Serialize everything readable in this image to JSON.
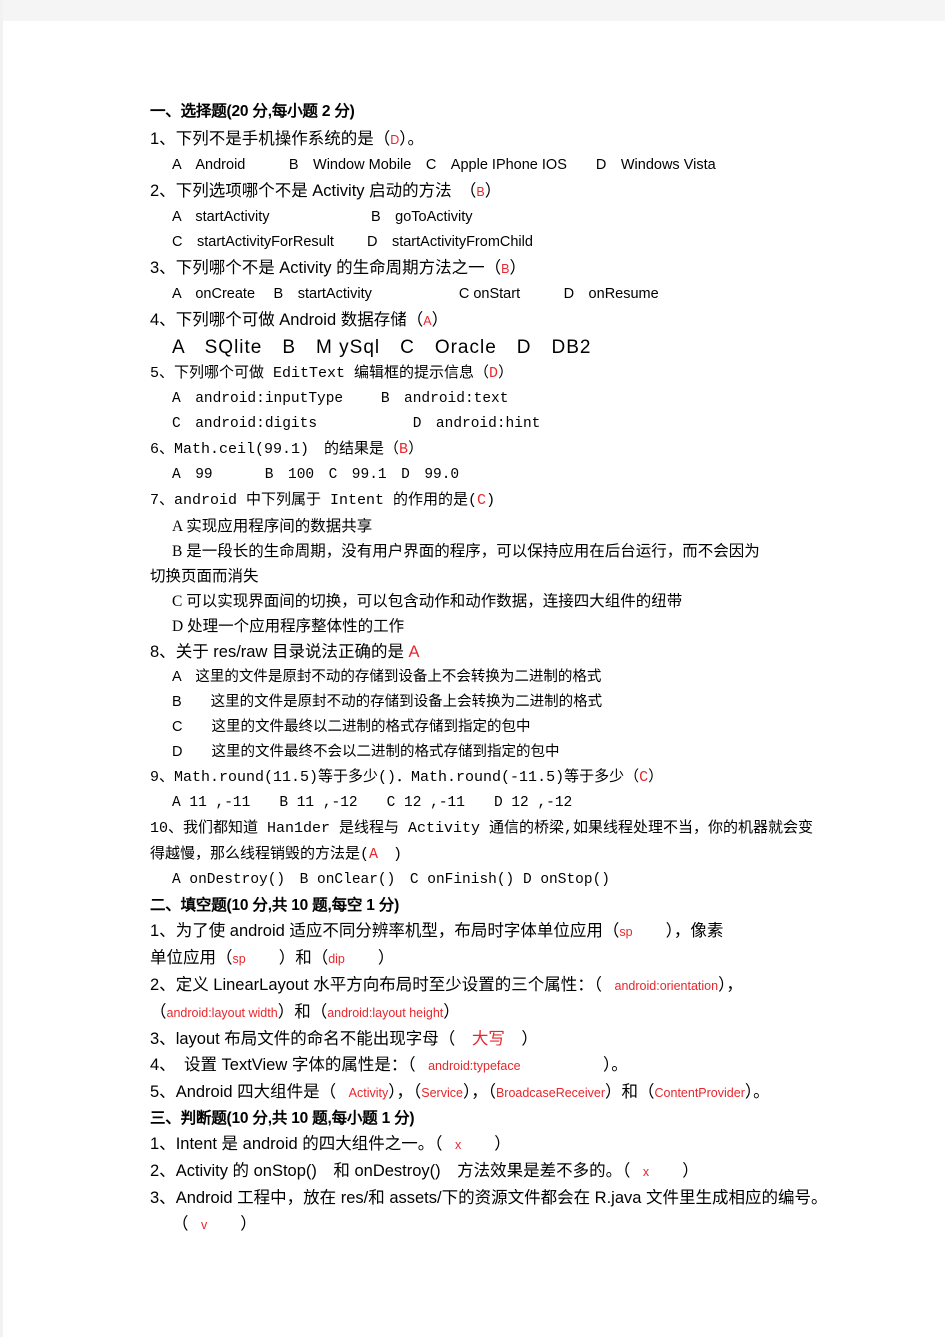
{
  "document": {
    "page_background": "#ffffff",
    "answer_color": "#e8262c",
    "text_color": "#000000"
  },
  "sections": [
    {
      "id": "section-1",
      "heading": "一、选择题(20 分,每小题 2 分)",
      "questions": [
        {
          "number": "1、",
          "stem": "下列不是手机操作系统的是（",
          "answer": "D",
          "stem_tail": "）。",
          "options_line": "A　Android　　　B　Window Mobile　C　Apple IPhone IOS　　D　Windows Vista"
        },
        {
          "number": "2、",
          "stem": "下列选项哪个不是 Activity 启动的方法　（",
          "answer": "B",
          "stem_tail": "）",
          "options_lines": [
            "A　startActivity　　　　　　　B　goToActivity",
            "C　startActivityForResult　　 D　startActivityFromChild"
          ]
        },
        {
          "number": "3、",
          "stem": "下列哪个不是 Activity 的生命周期方法之一（",
          "answer": "B",
          "stem_tail": "）",
          "options_lines": [
            "A　onCreate　 B　startActivity　　　　　　C onStart　　　D　onResume"
          ]
        },
        {
          "number": "4、",
          "stem": "下列哪个可做 Android 数据存储（",
          "answer": "A",
          "stem_tail": "）",
          "options_big": "A　SQlite　B　M ySql　C　Oracle　D　DB2"
        },
        {
          "number": "5、",
          "stem": "下列哪个可做 EditText 编辑框的提示信息（",
          "answer": "D",
          "stem_tail": "）",
          "options_lines": [
            "A　android:inputType　　 B　android:text",
            "C　android:digits　　　　　　 D　android:hint"
          ]
        },
        {
          "number": "6、",
          "stem": "Math.ceil(99.1)　的结果是（",
          "answer": "B",
          "stem_tail": "）",
          "options_lines": [
            "A　99　　　 B　100　C　99.1　D　99.0"
          ]
        },
        {
          "number": "7、",
          "stem": "android 中下列属于 Intent 的作用的是(",
          "answer": "C",
          "stem_tail": ")",
          "options_lines": [
            "A 实现应用程序间的数据共享",
            "B 是一段长的生命周期，没有用户界面的程序，可以保持应用在后台运行，而不会因为"
          ],
          "wrap_line": "切换页面而消失",
          "options_after": [
            "C 可以实现界面间的切换，可以包含动作和动作数据，连接四大组件的纽带",
            "D 处理一个应用程序整体性的工作"
          ]
        },
        {
          "number": "8、",
          "stem": "关于 res/raw 目录说法正确的是 ",
          "answer": "A",
          "stem_tail": "",
          "options_lines": [
            "A　这里的文件是原封不动的存储到设备上不会转换为二进制的格式",
            "B　　这里的文件是原封不动的存储到设备上会转换为二进制的格式",
            "C　　这里的文件最终以二进制的格式存储到指定的包中",
            "D　　这里的文件最终不会以二进制的格式存储到指定的包中"
          ]
        },
        {
          "number": "9、",
          "stem": "Math.round(11.5)等于多少()．Math.round(-11.5)等于多少（",
          "answer": "C",
          "stem_tail": "）",
          "options_lines": [
            "A 11 ,-11　　B 11 ,-12　　C 12 ,-11　　D 12 ,-12"
          ]
        },
        {
          "number": "10、",
          "stem": "我们都知道 Han1der 是线程与 Activity 通信的桥梁,如果线程处理不当，你的机器就会变",
          "wrap_line": "得越慢，那么线程销毁的方法是(",
          "answer": "A",
          "stem_tail": "　)",
          "options_lines": [
            "A onDestroy()　B onClear()　C onFinish() D onStop()"
          ]
        }
      ]
    },
    {
      "id": "section-2",
      "heading": "二、填空题(10 分,共 10 题,每空 1 分)",
      "fill_questions": [
        {
          "number": "1、",
          "parts": [
            {
              "t": "为了使 android 适应不同分辨率机型，布局时字体单位应用（",
              "k": "txt"
            },
            {
              "t": "sp",
              "k": "ans-sm"
            },
            {
              "t": "　　），像素",
              "k": "txt"
            }
          ],
          "line2": [
            {
              "t": "单位应用（",
              "k": "txt"
            },
            {
              "t": "sp",
              "k": "ans-sm"
            },
            {
              "t": "　　）和（",
              "k": "txt"
            },
            {
              "t": "dip",
              "k": "ans-sm"
            },
            {
              "t": "　　）",
              "k": "txt"
            }
          ]
        },
        {
          "number": "2、",
          "parts": [
            {
              "t": "定义 LinearLayout 水平方向布局时至少设置的三个属性：（",
              "k": "txt"
            },
            {
              "t": "　android:orientation",
              "k": "ans-sm"
            },
            {
              "t": "），",
              "k": "txt"
            }
          ],
          "line2": [
            {
              "t": "（",
              "k": "txt"
            },
            {
              "t": "android:layout width",
              "k": "ans-sm"
            },
            {
              "t": "）和（",
              "k": "txt"
            },
            {
              "t": "android:layout height",
              "k": "ans-sm"
            },
            {
              "t": "）",
              "k": "txt"
            }
          ]
        },
        {
          "number": "3、",
          "parts": [
            {
              "t": "layout 布局文件的命名不能出现字母（",
              "k": "txt"
            },
            {
              "t": "　大写",
              "k": "ans"
            },
            {
              "t": "　）",
              "k": "txt"
            }
          ]
        },
        {
          "number": "4、",
          "parts": [
            {
              "t": "　设置 TextView 字体的属性是：（",
              "k": "txt"
            },
            {
              "t": "　android:typeface",
              "k": "ans-sm"
            },
            {
              "t": "　　　　　）。",
              "k": "txt"
            }
          ]
        },
        {
          "number": "5、",
          "parts": [
            {
              "t": "Android 四大组件是（",
              "k": "txt"
            },
            {
              "t": "　Activity",
              "k": "ans-sm"
            },
            {
              "t": "），（",
              "k": "txt"
            },
            {
              "t": "Service",
              "k": "ans-sm"
            },
            {
              "t": "），（",
              "k": "txt"
            },
            {
              "t": "BroadcaseReceiver",
              "k": "ans-sm"
            },
            {
              "t": "）和（",
              "k": "txt"
            },
            {
              "t": "ContentProvider",
              "k": "ans-sm"
            },
            {
              "t": "）。",
              "k": "txt"
            }
          ]
        }
      ]
    },
    {
      "id": "section-3",
      "heading": "三、判断题(10 分,共 10 题,每小题 1 分)",
      "tf_questions": [
        {
          "number": "1、",
          "parts": [
            {
              "t": "Intent 是 android 的四大组件之一。（",
              "k": "txt"
            },
            {
              "t": "　x",
              "k": "ans-sm"
            },
            {
              "t": "　　）",
              "k": "txt"
            }
          ]
        },
        {
          "number": "2、",
          "parts": [
            {
              "t": "Activity 的 onStop()　和 onDestroy()　方法效果是差不多的。（",
              "k": "txt"
            },
            {
              "t": "　x",
              "k": "ans-sm"
            },
            {
              "t": "　　）",
              "k": "txt"
            }
          ]
        },
        {
          "number": "3、",
          "parts": [
            {
              "t": "Android 工程中，放在 res/和 assets/下的资源文件都会在 R.java 文件里生成相应的编号。",
              "k": "txt"
            }
          ],
          "line2": [
            {
              "t": "（",
              "k": "txt"
            },
            {
              "t": "　v",
              "k": "ans-sm"
            },
            {
              "t": "　　）",
              "k": "txt"
            }
          ]
        }
      ]
    }
  ]
}
